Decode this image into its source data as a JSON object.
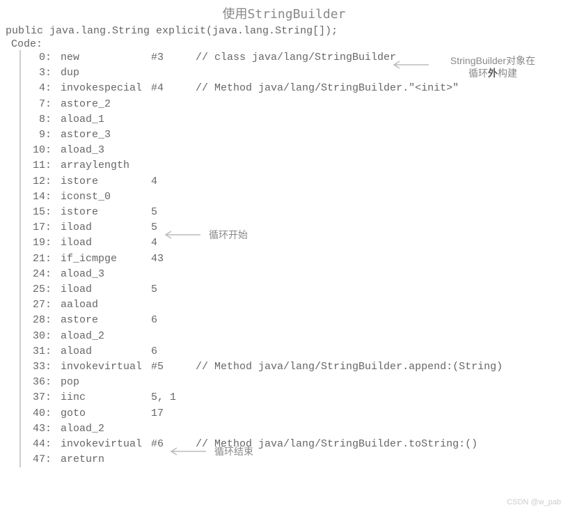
{
  "title": "使用StringBuilder",
  "signature": "public java.lang.String explicit(java.lang.String[]);",
  "code_label": "Code:",
  "instructions": [
    {
      "offset": "0:",
      "instr": "new",
      "arg": "#3",
      "comment": "// class java/lang/StringBuilder"
    },
    {
      "offset": "3:",
      "instr": "dup",
      "arg": "",
      "comment": ""
    },
    {
      "offset": "4:",
      "instr": "invokespecial",
      "arg": "#4",
      "comment": "// Method java/lang/StringBuilder.\"<init>\""
    },
    {
      "offset": "7:",
      "instr": "astore_2",
      "arg": "",
      "comment": ""
    },
    {
      "offset": "8:",
      "instr": "aload_1",
      "arg": "",
      "comment": ""
    },
    {
      "offset": "9:",
      "instr": "astore_3",
      "arg": "",
      "comment": ""
    },
    {
      "offset": "10:",
      "instr": "aload_3",
      "arg": "",
      "comment": ""
    },
    {
      "offset": "11:",
      "instr": "arraylength",
      "arg": "",
      "comment": ""
    },
    {
      "offset": "12:",
      "instr": "istore",
      "arg": "4",
      "comment": ""
    },
    {
      "offset": "14:",
      "instr": "iconst_0",
      "arg": "",
      "comment": ""
    },
    {
      "offset": "15:",
      "instr": "istore",
      "arg": "5",
      "comment": ""
    },
    {
      "offset": "17:",
      "instr": "iload",
      "arg": "5",
      "comment": ""
    },
    {
      "offset": "19:",
      "instr": "iload",
      "arg": "4",
      "comment": ""
    },
    {
      "offset": "21:",
      "instr": "if_icmpge",
      "arg": "43",
      "comment": ""
    },
    {
      "offset": "24:",
      "instr": "aload_3",
      "arg": "",
      "comment": ""
    },
    {
      "offset": "25:",
      "instr": "iload",
      "arg": "5",
      "comment": ""
    },
    {
      "offset": "27:",
      "instr": "aaload",
      "arg": "",
      "comment": ""
    },
    {
      "offset": "28:",
      "instr": "astore",
      "arg": "6",
      "comment": ""
    },
    {
      "offset": "30:",
      "instr": "aload_2",
      "arg": "",
      "comment": ""
    },
    {
      "offset": "31:",
      "instr": "aload",
      "arg": "6",
      "comment": ""
    },
    {
      "offset": "33:",
      "instr": "invokevirtual",
      "arg": "#5",
      "comment": "// Method java/lang/StringBuilder.append:(String)"
    },
    {
      "offset": "36:",
      "instr": "pop",
      "arg": "",
      "comment": ""
    },
    {
      "offset": "37:",
      "instr": "iinc",
      "arg": "5, 1",
      "comment": ""
    },
    {
      "offset": "40:",
      "instr": "goto",
      "arg": "17",
      "comment": ""
    },
    {
      "offset": "43:",
      "instr": "aload_2",
      "arg": "",
      "comment": ""
    },
    {
      "offset": "44:",
      "instr": "invokevirtual",
      "arg": "#6",
      "comment": "// Method java/lang/StringBuilder.toString:()"
    },
    {
      "offset": "47:",
      "instr": "areturn",
      "arg": "",
      "comment": ""
    }
  ],
  "annotations": {
    "a1_line1": "StringBuilder对象在",
    "a1_line2_pre": "循环",
    "a1_line2_bold": "外",
    "a1_line2_post": "构建",
    "a2": "循环开始",
    "a3": "循环结束"
  },
  "watermark": "CSDN @w_pab"
}
